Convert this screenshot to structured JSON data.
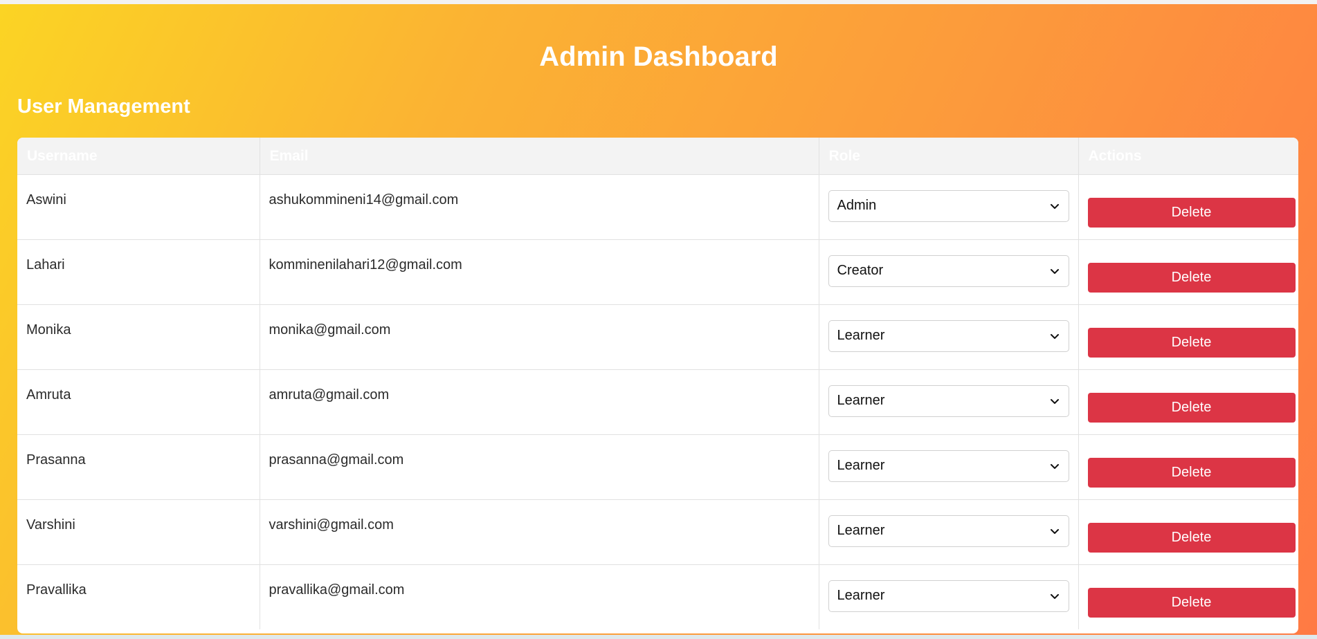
{
  "header": {
    "title": "Admin Dashboard",
    "section_title": "User Management"
  },
  "table": {
    "columns": [
      "Username",
      "Email",
      "Role",
      "Actions"
    ],
    "rows": [
      {
        "username": "Aswini",
        "email": "ashukommineni14@gmail.com",
        "role": "Admin",
        "action": "Delete"
      },
      {
        "username": "Lahari",
        "email": "komminenilahari12@gmail.com",
        "role": "Creator",
        "action": "Delete"
      },
      {
        "username": "Monika",
        "email": "monika@gmail.com",
        "role": "Learner",
        "action": "Delete"
      },
      {
        "username": "Amruta",
        "email": "amruta@gmail.com",
        "role": "Learner",
        "action": "Delete"
      },
      {
        "username": "Prasanna",
        "email": "prasanna@gmail.com",
        "role": "Learner",
        "action": "Delete"
      },
      {
        "username": "Varshini",
        "email": "varshini@gmail.com",
        "role": "Learner",
        "action": "Delete"
      },
      {
        "username": "Pravallika",
        "email": "pravallika@gmail.com",
        "role": "Learner",
        "action": "Delete"
      }
    ]
  },
  "colors": {
    "gradient_start": "#fbd424",
    "gradient_end": "#ff7a44",
    "delete_button": "#dc3545",
    "header_bg": "#f3f3f3"
  },
  "icons": {
    "select": "chevron-down-icon"
  }
}
